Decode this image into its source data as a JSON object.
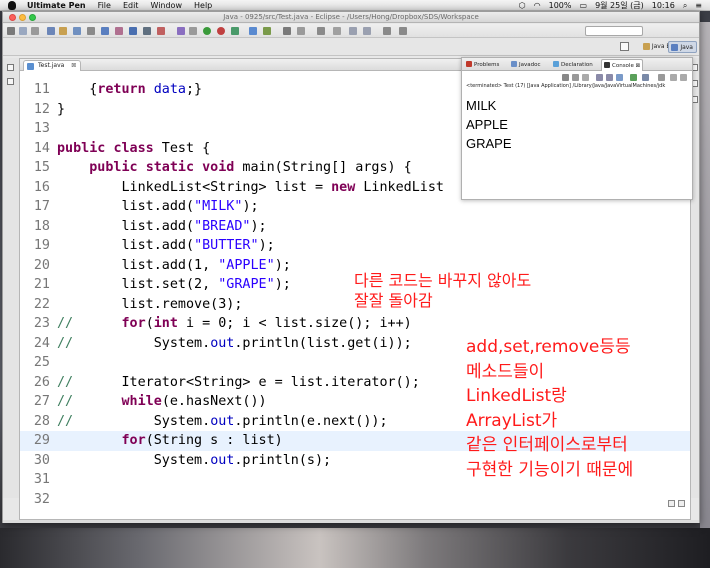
{
  "menubar": {
    "app_name": "Ultimate Pen",
    "items": [
      "File",
      "Edit",
      "Window",
      "Help"
    ],
    "battery": "100%",
    "date": "9월 25일 (금)",
    "time": "10:16"
  },
  "window": {
    "title": "Java - 0925/src/Test.java - Eclipse - /Users/Hong/Dropbox/SDS/Workspace"
  },
  "perspectives": {
    "java_ee": "Java EE",
    "java": "Java"
  },
  "editor": {
    "tab_label": "Test.java",
    "tab_close": "⊠",
    "current_line": "29",
    "lines": [
      {
        "n": "11",
        "text": "    {return data;}"
      },
      {
        "n": "12",
        "text": "}"
      },
      {
        "n": "13",
        "text": ""
      },
      {
        "n": "14",
        "text": "public class Test {"
      },
      {
        "n": "15",
        "text": "    public static void main(String[] args) {"
      },
      {
        "n": "16",
        "text": "        LinkedList<String> list = new LinkedList"
      },
      {
        "n": "17",
        "text": "        list.add(\"MILK\");"
      },
      {
        "n": "18",
        "text": "        list.add(\"BREAD\");"
      },
      {
        "n": "19",
        "text": "        list.add(\"BUTTER\");"
      },
      {
        "n": "20",
        "text": "        list.add(1, \"APPLE\");"
      },
      {
        "n": "21",
        "text": "        list.set(2, \"GRAPE\");"
      },
      {
        "n": "22",
        "text": "        list.remove(3);"
      },
      {
        "n": "23",
        "text": "//      for(int i = 0; i < list.size(); i++)"
      },
      {
        "n": "24",
        "text": "//          System.out.println(list.get(i));"
      },
      {
        "n": "25",
        "text": ""
      },
      {
        "n": "26",
        "text": "//      Iterator<String> e = list.iterator();"
      },
      {
        "n": "27",
        "text": "//      while(e.hasNext())"
      },
      {
        "n": "28",
        "text": "//          System.out.println(e.next());"
      },
      {
        "n": "29",
        "text": "        for(String s : list)"
      },
      {
        "n": "30",
        "text": "            System.out.println(s);"
      },
      {
        "n": "31",
        "text": ""
      },
      {
        "n": "32",
        "text": ""
      }
    ]
  },
  "annotations": {
    "note1": "다른 코드는 바꾸지 않아도\n잘잘 돌아감",
    "note2": "add,set,remove등등\n메소드들이\nLinkedList랑\nArrayList가\n같은 인터페이스로부터\n구현한 기능이기 때문에"
  },
  "console": {
    "tabs": [
      {
        "label": "Problems",
        "color": "#c0392b"
      },
      {
        "label": "Javadoc",
        "color": "#6a8fc8"
      },
      {
        "label": "Declaration",
        "color": "#5aa0d8"
      },
      {
        "label": "Console",
        "color": "#333333",
        "close": "⊠"
      }
    ],
    "status": "<terminated> Test (17) [Java Application] /Library/Java/JavaVirtualMachines/jdk",
    "output": [
      "MILK",
      "APPLE",
      "GRAPE"
    ]
  },
  "colors": {
    "keyword": "#7f0055",
    "string": "#2a00ff",
    "field": "#0000c0",
    "comment": "#3f7f5f",
    "annotation": "#ff1a1a",
    "current_line_bg": "#e8f2fe"
  }
}
